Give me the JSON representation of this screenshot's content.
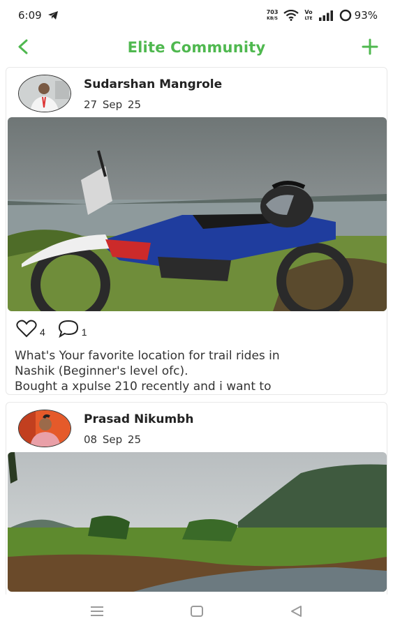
{
  "status_bar": {
    "time": "6:09",
    "speed_value": "703",
    "speed_unit": "KB/S",
    "volte_top": "Vo",
    "volte_bottom": "LTE",
    "battery": "93%"
  },
  "header": {
    "title": "Elite Community",
    "accent_color": "#4fb84f"
  },
  "posts": [
    {
      "author": "Sudarshan Mangrole",
      "date": "27  Sep 25",
      "likes": "4",
      "comments": "1",
      "text_lines": [
        "What's Your favorite location for trail rides in",
        "Nashik (Beginner's level ofc).",
        "Bought a xpulse 210 recently and i want to"
      ]
    },
    {
      "author": "Prasad Nikumbh",
      "date": "08  Sep 25"
    }
  ],
  "icons": {
    "back": "arrow-left-icon",
    "add": "plus-icon",
    "like": "heart-icon",
    "comment": "comment-bubble-icon",
    "nav_recents": "menu-lines-icon",
    "nav_home": "square-home-icon",
    "nav_back": "triangle-back-icon"
  }
}
